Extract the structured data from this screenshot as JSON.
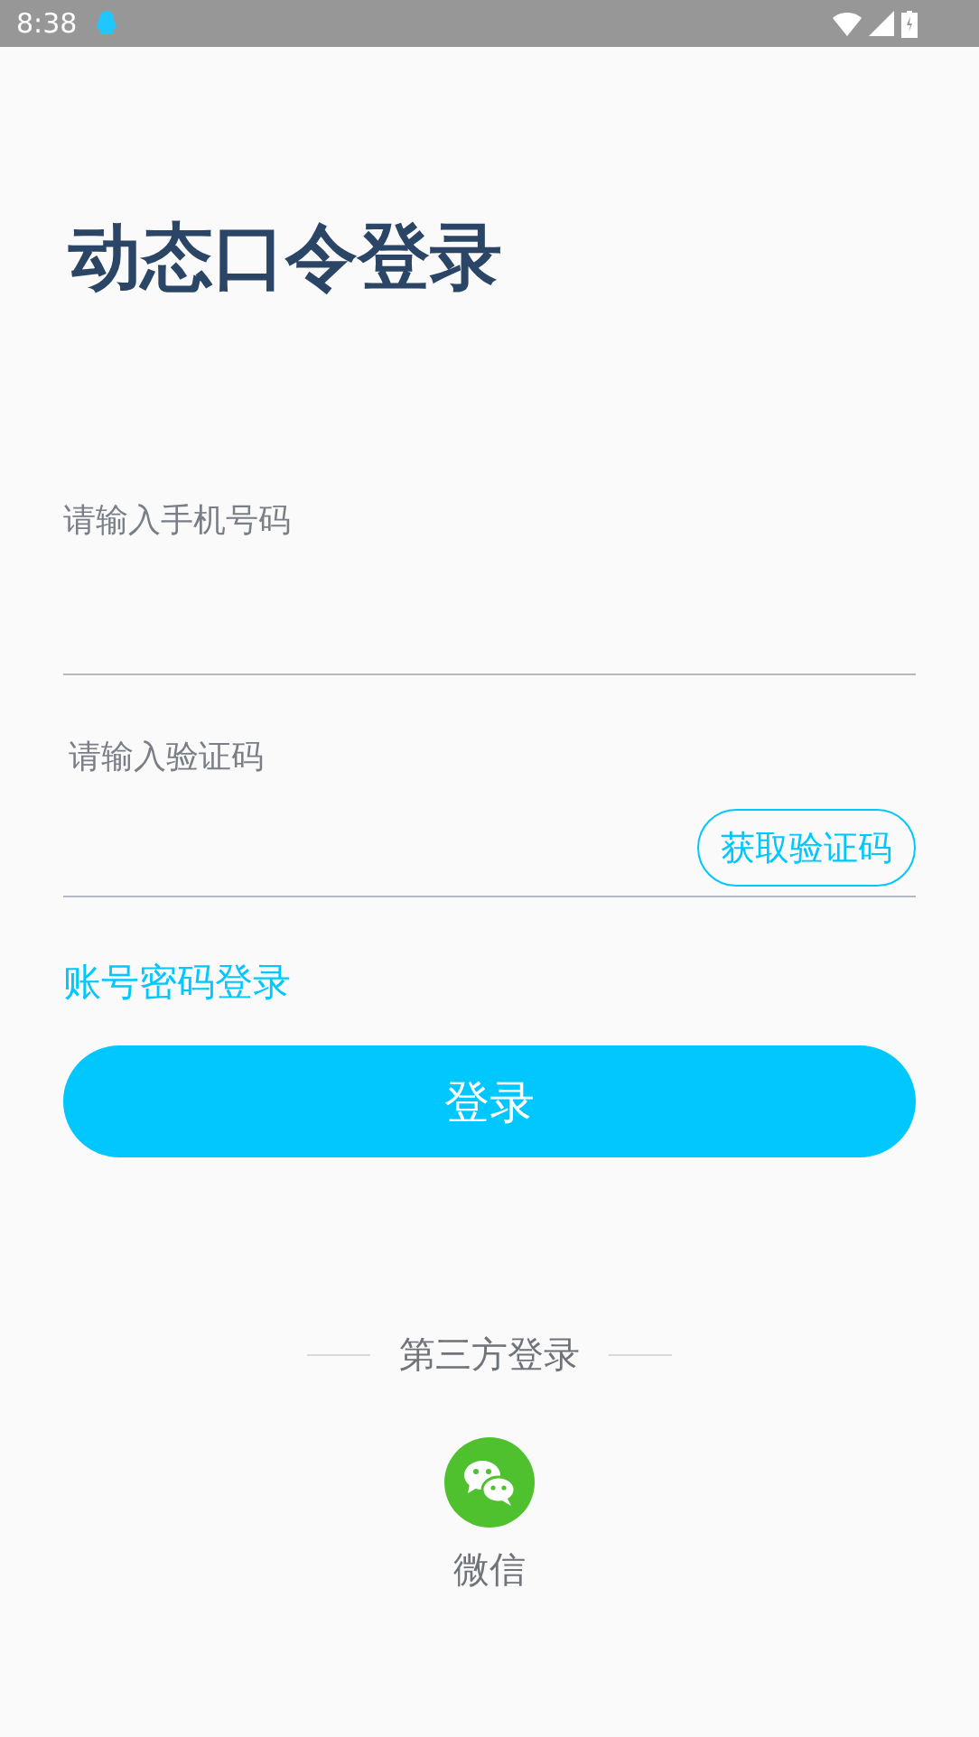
{
  "status_bar": {
    "time": "8:38"
  },
  "title": "动态口令登录",
  "phone_field": {
    "placeholder": "请输入手机号码"
  },
  "code_field": {
    "placeholder": "请输入验证码"
  },
  "get_code_button": "获取验证码",
  "password_login_link": "账号密码登录",
  "login_button": "登录",
  "third_party": {
    "label": "第三方登录",
    "items": [
      {
        "label": "微信"
      }
    ]
  }
}
